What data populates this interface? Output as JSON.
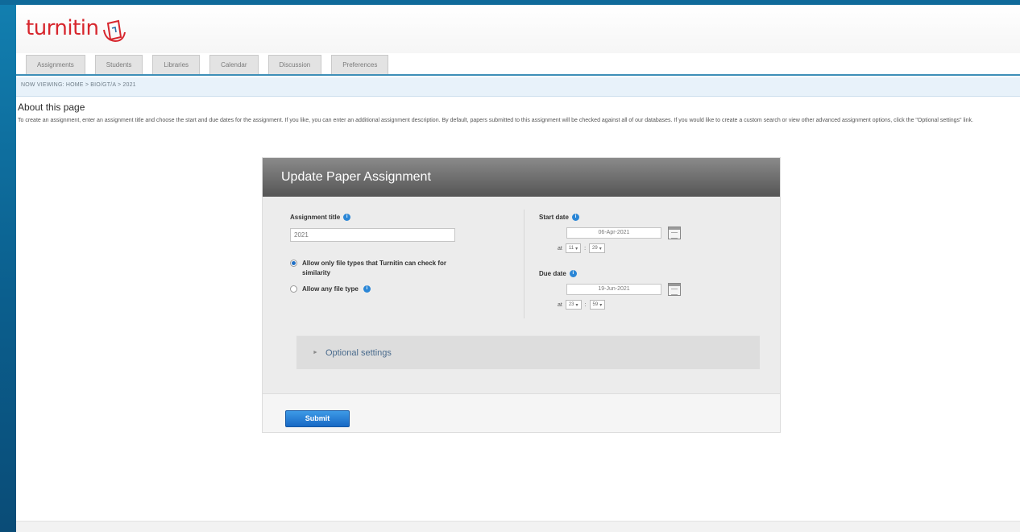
{
  "brand": {
    "name": "turnitin",
    "color": "#d7262d"
  },
  "tabs": [
    "Assignments",
    "Students",
    "Libraries",
    "Calendar",
    "Discussion",
    "Preferences"
  ],
  "breadcrumb": "NOW VIEWING: HOME > BIO/GT/A > 2021",
  "about": {
    "title": "About this page",
    "text": "To create an assignment, enter an assignment title and choose the start and due dates for the assignment. If you like, you can enter an additional assignment description. By default, papers submitted to this assignment will be checked against all of our databases. If you would like to create a custom search or view other advanced assignment options, click the \"Optional settings\" link."
  },
  "form": {
    "heading": "Update Paper Assignment",
    "title_label": "Assignment title",
    "title_value": "2021",
    "radio_similarity": "Allow only file types that Turnitin can check for similarity",
    "radio_any": "Allow any file type",
    "start_label": "Start date",
    "start_date": "06-Apr-2021",
    "start_hour": "11",
    "start_minute": "29",
    "due_label": "Due date",
    "due_date": "19-Jun-2021",
    "due_hour": "23",
    "due_minute": "59",
    "at_label": "at",
    "time_sep": ":",
    "optional_label": "Optional settings",
    "submit_label": "Submit"
  },
  "icons": {
    "info": "info-icon",
    "calendar": "calendar-icon",
    "dropdown": "chevron-down-icon",
    "expand": "chevron-right-icon"
  },
  "colors": {
    "accent": "#1768c4",
    "header_bg": "#555555",
    "tab_rule": "#3d8fb8"
  }
}
